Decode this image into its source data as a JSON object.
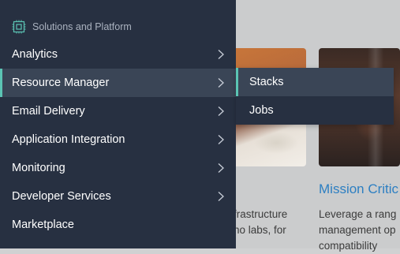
{
  "nav": {
    "header": {
      "label": "Solutions and Platform",
      "icon": "chip-icon"
    },
    "items": [
      {
        "label": "Analytics",
        "has_submenu": true
      },
      {
        "label": "Resource Manager",
        "has_submenu": true,
        "active": true
      },
      {
        "label": "Email Delivery",
        "has_submenu": true
      },
      {
        "label": "Application Integration",
        "has_submenu": true
      },
      {
        "label": "Monitoring",
        "has_submenu": true
      },
      {
        "label": "Developer Services",
        "has_submenu": true
      },
      {
        "label": "Marketplace",
        "has_submenu": false
      }
    ]
  },
  "submenu": {
    "items": [
      {
        "label": "Stacks",
        "active": true
      },
      {
        "label": "Jobs"
      }
    ]
  },
  "background": {
    "card1": {
      "text_line1": "frastructure",
      "text_line2": "no labs, for"
    },
    "card2": {
      "title": "Mission Critic",
      "text_line1": "Leverage a rang",
      "text_line2": "management op",
      "text_line3": "compatibility"
    }
  },
  "colors": {
    "nav_bg": "#273041",
    "nav_active_bg": "#3a4556",
    "accent": "#5bc4b4",
    "link": "#2d7fc2"
  }
}
